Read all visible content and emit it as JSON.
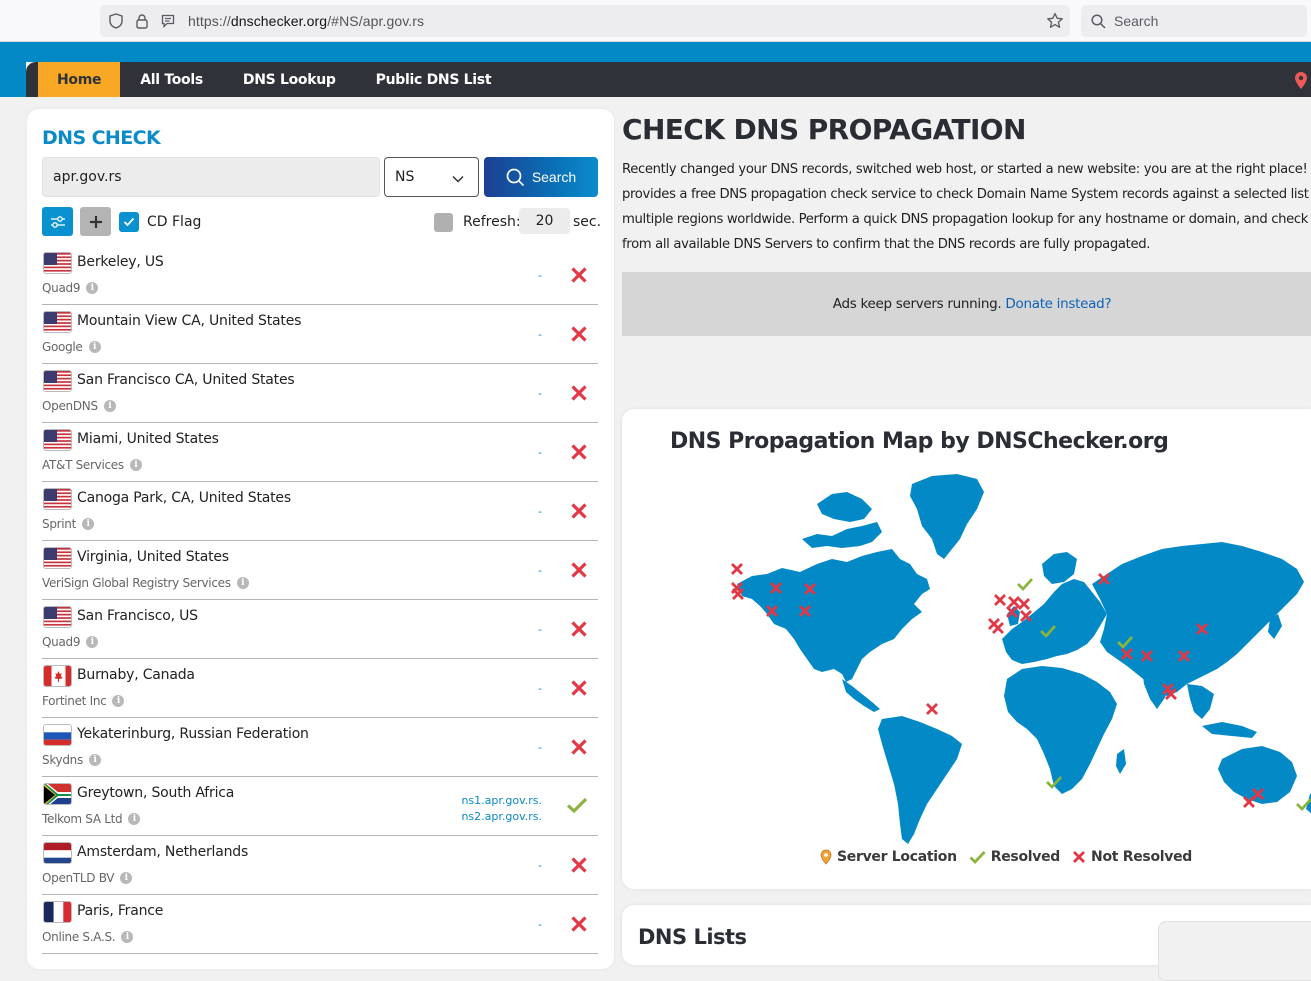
{
  "browser": {
    "url_prefix": "https://",
    "url_host": "dnschecker.org",
    "url_path": "/#NS/apr.gov.rs",
    "search_placeholder": "Search"
  },
  "nav": {
    "items": [
      {
        "label": "Home",
        "active": true
      },
      {
        "label": "All Tools",
        "active": false
      },
      {
        "label": "DNS Lookup",
        "active": false
      },
      {
        "label": "Public DNS List",
        "active": false
      }
    ]
  },
  "dns_check": {
    "title": "DNS CHECK",
    "domain_value": "apr.gov.rs",
    "record_type": "NS",
    "search_label": "Search",
    "cd_flag_label": "CD Flag",
    "cd_flag_checked": true,
    "refresh_label": "Refresh:",
    "refresh_value": "20",
    "refresh_unit": "sec.",
    "refresh_checked": false
  },
  "servers": [
    {
      "location": "Berkeley, US",
      "provider": "Quad9",
      "flag": "us",
      "result": [
        "-"
      ],
      "status": "not-resolved"
    },
    {
      "location": "Mountain View CA, United States",
      "provider": "Google",
      "flag": "us",
      "result": [
        "-"
      ],
      "status": "not-resolved"
    },
    {
      "location": "San Francisco CA, United States",
      "provider": "OpenDNS",
      "flag": "us",
      "result": [
        "-"
      ],
      "status": "not-resolved"
    },
    {
      "location": "Miami, United States",
      "provider": "AT&T Services",
      "flag": "us",
      "result": [
        "-"
      ],
      "status": "not-resolved"
    },
    {
      "location": "Canoga Park, CA, United States",
      "provider": "Sprint",
      "flag": "us",
      "result": [
        "-"
      ],
      "status": "not-resolved"
    },
    {
      "location": "Virginia, United States",
      "provider": "VeriSign Global Registry Services",
      "flag": "us",
      "result": [
        "-"
      ],
      "status": "not-resolved"
    },
    {
      "location": "San Francisco, US",
      "provider": "Quad9",
      "flag": "us",
      "result": [
        "-"
      ],
      "status": "not-resolved"
    },
    {
      "location": "Burnaby, Canada",
      "provider": "Fortinet Inc",
      "flag": "ca",
      "result": [
        "-"
      ],
      "status": "not-resolved"
    },
    {
      "location": "Yekaterinburg, Russian Federation",
      "provider": "Skydns",
      "flag": "ru",
      "result": [
        "-"
      ],
      "status": "not-resolved"
    },
    {
      "location": "Greytown, South Africa",
      "provider": "Telkom SA Ltd",
      "flag": "za",
      "result": [
        "ns1.apr.gov.rs.",
        "ns2.apr.gov.rs."
      ],
      "status": "resolved"
    },
    {
      "location": "Amsterdam, Netherlands",
      "provider": "OpenTLD BV",
      "flag": "nl",
      "result": [
        "-"
      ],
      "status": "not-resolved"
    },
    {
      "location": "Paris, France",
      "provider": "Online S.A.S.",
      "flag": "fr",
      "result": [
        "-"
      ],
      "status": "not-resolved"
    }
  ],
  "main": {
    "title": "CHECK DNS PROPAGATION",
    "description_lines": [
      "Recently changed your DNS records, switched web host, or started a new website: you are at the right place! D",
      "provides a free DNS propagation check service to check Domain Name System records against a selected list of",
      "multiple regions worldwide. Perform a quick DNS propagation lookup for any hostname or domain, and check D",
      "from all available DNS Servers to confirm that the DNS records are fully propagated."
    ],
    "ad_text": "Ads keep servers running.",
    "ad_link": "Donate instead?"
  },
  "map": {
    "title": "DNS Propagation Map by DNSChecker.org",
    "legend": {
      "server_location": "Server Location",
      "resolved": "Resolved",
      "not_resolved": "Not Resolved"
    },
    "markers": [
      {
        "region": "Vancouver",
        "status": "not-resolved"
      },
      {
        "region": "California North",
        "status": "not-resolved"
      },
      {
        "region": "California South",
        "status": "not-resolved"
      },
      {
        "region": "Kansas",
        "status": "not-resolved"
      },
      {
        "region": "New York",
        "status": "not-resolved"
      },
      {
        "region": "Texas",
        "status": "not-resolved"
      },
      {
        "region": "Miami",
        "status": "not-resolved"
      },
      {
        "region": "Brazil",
        "status": "not-resolved"
      },
      {
        "region": "UK",
        "status": "not-resolved"
      },
      {
        "region": "Netherlands",
        "status": "not-resolved"
      },
      {
        "region": "Germany",
        "status": "not-resolved"
      },
      {
        "region": "France",
        "status": "not-resolved"
      },
      {
        "region": "Switzerland",
        "status": "not-resolved"
      },
      {
        "region": "Spain",
        "status": "not-resolved"
      },
      {
        "region": "Portugal",
        "status": "not-resolved"
      },
      {
        "region": "Denmark",
        "status": "resolved"
      },
      {
        "region": "Turkey",
        "status": "resolved"
      },
      {
        "region": "Russia",
        "status": "not-resolved"
      },
      {
        "region": "Pakistan",
        "status": "resolved"
      },
      {
        "region": "India North",
        "status": "not-resolved"
      },
      {
        "region": "India East",
        "status": "not-resolved"
      },
      {
        "region": "China South",
        "status": "not-resolved"
      },
      {
        "region": "Korea",
        "status": "not-resolved"
      },
      {
        "region": "Malaysia",
        "status": "not-resolved"
      },
      {
        "region": "Singapore",
        "status": "not-resolved"
      },
      {
        "region": "South Africa",
        "status": "resolved"
      },
      {
        "region": "Melbourne",
        "status": "not-resolved"
      },
      {
        "region": "Sydney",
        "status": "not-resolved"
      },
      {
        "region": "New Zealand",
        "status": "resolved"
      }
    ]
  },
  "dns_lists": {
    "title": "DNS Lists"
  },
  "colors": {
    "brand_blue": "#0289c6",
    "nav_dark": "#2f3239",
    "active_tab": "#f9a825",
    "resolved": "#8bb43e",
    "not_resolved": "#e23744",
    "map_land": "#0289c6"
  }
}
